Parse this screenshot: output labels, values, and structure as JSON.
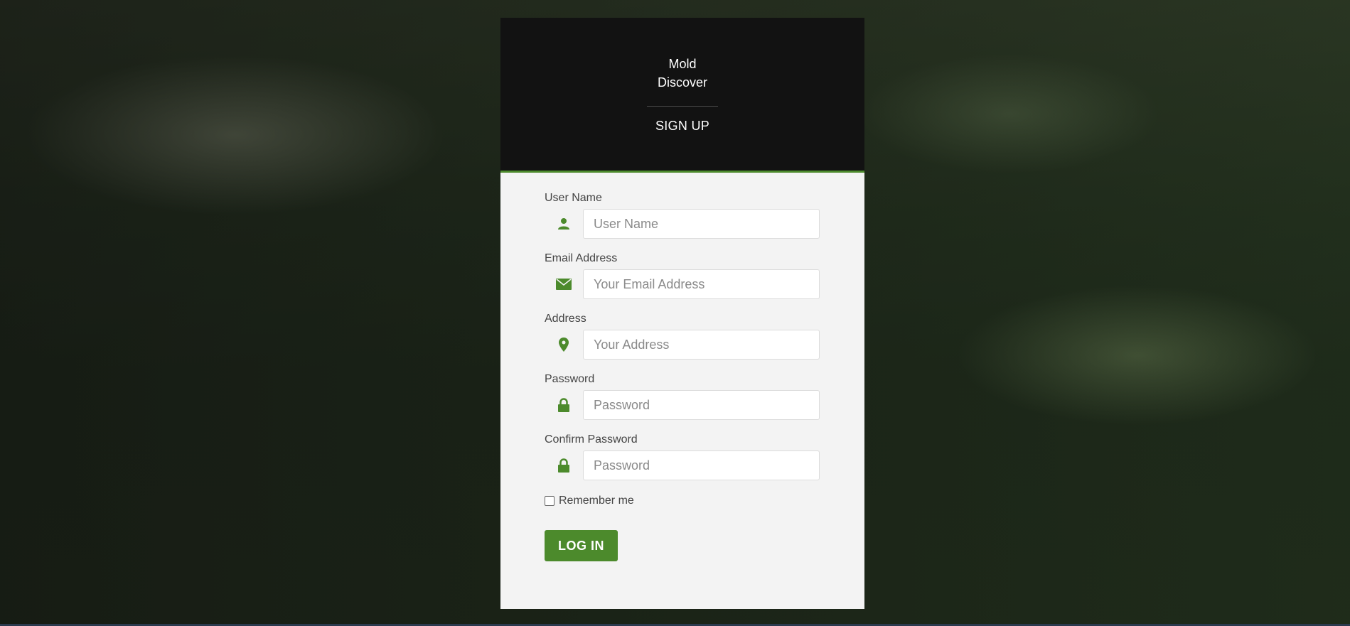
{
  "header": {
    "brand_line1": "Mold",
    "brand_line2": "Discover",
    "title": "SIGN UP"
  },
  "form": {
    "fields": [
      {
        "label": "User Name",
        "placeholder": "User Name",
        "value": "",
        "icon": "user-icon"
      },
      {
        "label": "Email Address",
        "placeholder": "Your Email Address",
        "value": "",
        "icon": "envelope-icon"
      },
      {
        "label": "Address",
        "placeholder": "Your Address",
        "value": "",
        "icon": "map-marker-icon"
      },
      {
        "label": "Password",
        "placeholder": "Password",
        "value": "",
        "icon": "lock-icon"
      },
      {
        "label": "Confirm Password",
        "placeholder": "Password",
        "value": "",
        "icon": "lock-icon"
      }
    ],
    "remember_label": "Remember me",
    "remember_checked": false,
    "submit_label": "LOG IN"
  },
  "colors": {
    "accent": "#4c8a2c",
    "header_bg": "#121212",
    "body_bg": "#f3f3f3"
  }
}
